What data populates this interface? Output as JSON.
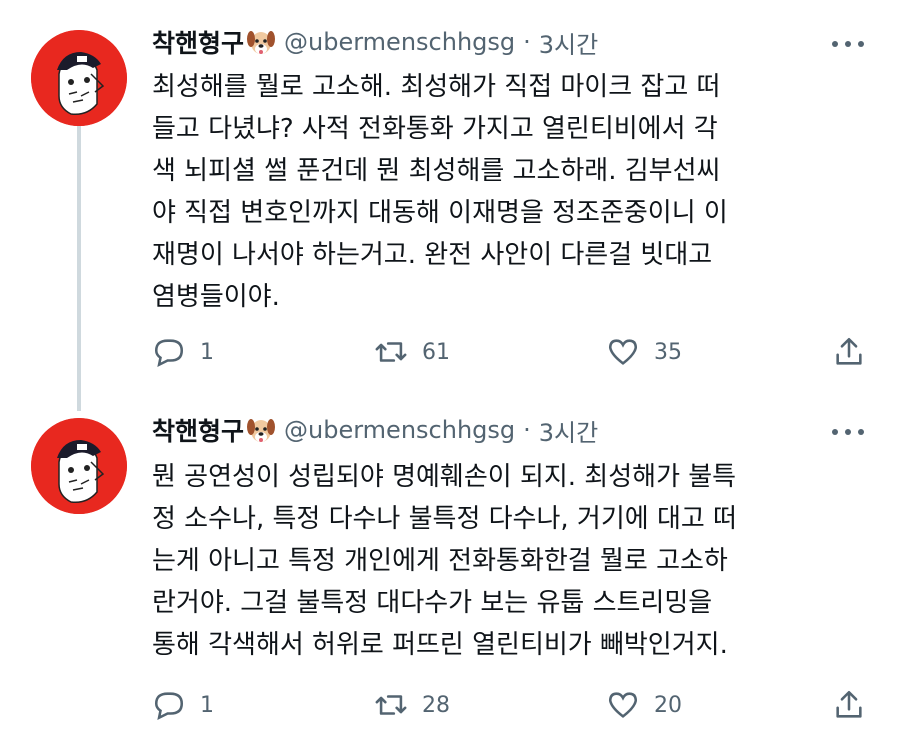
{
  "tweets": [
    {
      "author": {
        "name": "착핸형구",
        "handle": "@ubermenschhgsg",
        "emoji_icon": "dog-face-icon"
      },
      "separator": "·",
      "time": "3시간",
      "lines": [
        "최성해를 뭘로 고소해. 최성해가 직접 마이크 잡고 떠",
        "들고 다녔냐? 사적 전화통화 가지고 열린티비에서 각",
        "색 뇌피셜 썰 푼건데 뭔 최성해를 고소하래. 김부선씨",
        "야 직접 변호인까지 대동해 이재명을 정조준중이니 이",
        "재명이 나서야 하는거고. 완전 사안이 다른걸 빗대고",
        "염병들이야."
      ],
      "stats": {
        "replies": "1",
        "retweets": "61",
        "likes": "35"
      }
    },
    {
      "author": {
        "name": "착핸형구",
        "handle": "@ubermenschhgsg",
        "emoji_icon": "dog-face-icon"
      },
      "separator": "·",
      "time": "3시간",
      "lines": [
        "뭔 공연성이 성립되야 명예훼손이 되지. 최성해가 불특",
        "정 소수나, 특정 다수나 불특정 다수나, 거기에 대고 떠",
        "는게 아니고 특정 개인에게 전화통화한걸 뭘로 고소하",
        "란거야. 그걸 불특정 대다수가 보는 유툽 스트리밍을",
        "통해 각색해서 허위로 퍼뜨린 열린티비가 빼박인거지."
      ],
      "stats": {
        "replies": "1",
        "retweets": "28",
        "likes": "20"
      }
    }
  ],
  "colors": {
    "avatar_bg": "#e8281f",
    "secondary_text": "#536471",
    "thread_line": "#cfd9de"
  }
}
